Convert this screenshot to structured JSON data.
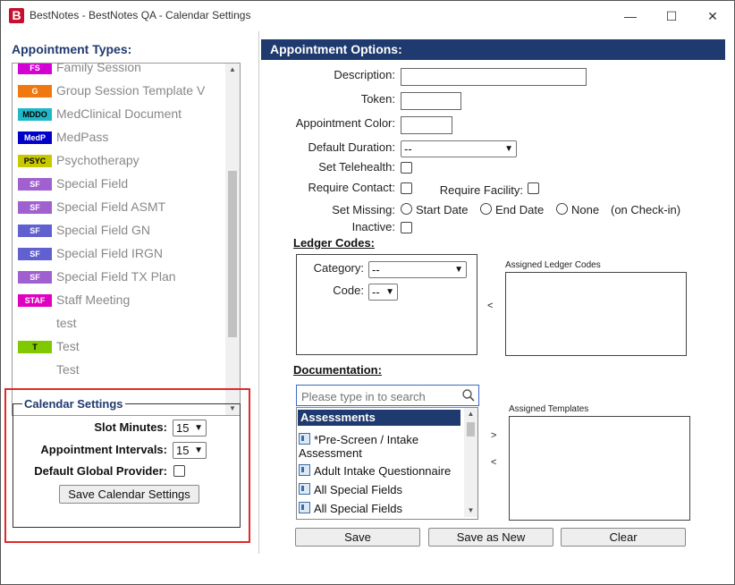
{
  "window": {
    "title": "BestNotes - BestNotes QA - Calendar Settings",
    "logo_letter": "B",
    "minimize": "—",
    "maximize": "☐",
    "close": "✕"
  },
  "appointment_types": {
    "label": "Appointment Types:",
    "items": [
      {
        "badge": "FS",
        "name": "Family Session",
        "color": "#d400d4"
      },
      {
        "badge": "G",
        "name": "Group Session Template V",
        "color": "#f07810"
      },
      {
        "badge": "MDDO",
        "name": "MedClinical Document",
        "color": "#20b8c8"
      },
      {
        "badge": "MedP",
        "name": "MedPass",
        "color": "#0000c8"
      },
      {
        "badge": "PSYC",
        "name": "Psychotherapy",
        "color": "#c8c800"
      },
      {
        "badge": "SF",
        "name": "Special Field",
        "color": "#a060d0"
      },
      {
        "badge": "SF",
        "name": "Special Field ASMT",
        "color": "#a060d0"
      },
      {
        "badge": "SF",
        "name": "Special Field GN",
        "color": "#6060d0"
      },
      {
        "badge": "SF",
        "name": "Special Field IRGN",
        "color": "#6060d0"
      },
      {
        "badge": "SF",
        "name": "Special Field TX Plan",
        "color": "#a060d0"
      },
      {
        "badge": "STAF",
        "name": "Staff Meeting",
        "color": "#e000c0"
      },
      {
        "badge": "",
        "name": "test",
        "color": ""
      },
      {
        "badge": "T",
        "name": "Test",
        "color": "#80c800"
      },
      {
        "badge": "",
        "name": "Test",
        "color": ""
      }
    ]
  },
  "calendar_settings": {
    "legend": "Calendar Settings",
    "slot_minutes_label": "Slot Minutes:",
    "slot_minutes_value": "15",
    "appointment_intervals_label": "Appointment Intervals:",
    "appointment_intervals_value": "15",
    "default_global_provider_label": "Default Global Provider:",
    "save_button": "Save Calendar Settings"
  },
  "appointment_options": {
    "header": "Appointment Options:",
    "description_label": "Description:",
    "token_label": "Token:",
    "color_label": "Appointment Color:",
    "duration_label": "Default Duration:",
    "duration_value": "--",
    "telehealth_label": "Set Telehealth:",
    "require_contact_label": "Require Contact:",
    "require_facility_label": "Require Facility:",
    "set_missing_label": "Set Missing:",
    "start_date_label": "Start Date",
    "end_date_label": "End Date",
    "none_label": "None",
    "on_checkin_label": "(on Check-in)",
    "inactive_label": "Inactive:"
  },
  "ledger_codes": {
    "label": "Ledger Codes:",
    "category_label": "Category:",
    "category_value": "--",
    "code_label": "Code:",
    "code_value": "--",
    "remove_arrow": "<",
    "assigned_label": "Assigned Ledger Codes"
  },
  "documentation": {
    "label": "Documentation:",
    "search_placeholder": "Please type in to search",
    "group_header": "Assessments",
    "items": [
      "*Pre-Screen / Intake Assessment",
      "Adult Intake Questionnaire",
      "All Special Fields",
      "All Special Fields"
    ],
    "add_arrow": ">",
    "remove_arrow": "<",
    "assigned_label": "Assigned Templates"
  },
  "actions": {
    "save": "Save",
    "save_as_new": "Save as New",
    "clear": "Clear"
  }
}
